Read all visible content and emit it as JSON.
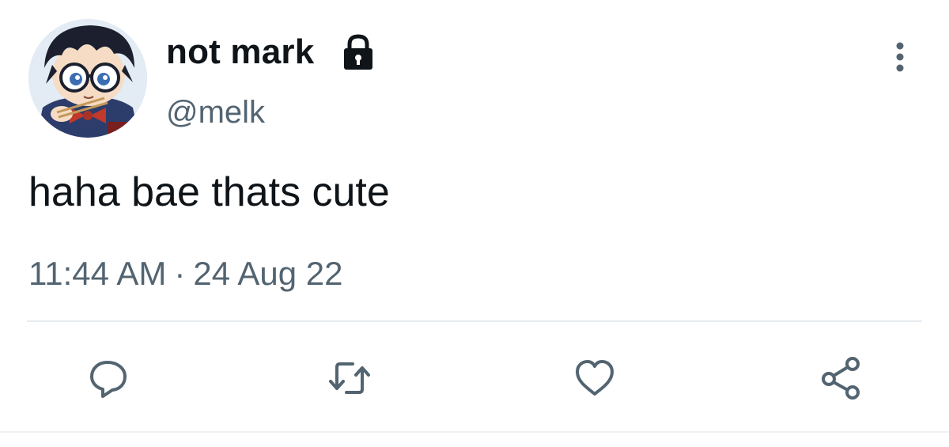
{
  "tweet": {
    "display_name": "not mark",
    "handle": "@melk",
    "text": "haha bae thats cute",
    "time": "11:44 AM",
    "separator": "·",
    "date": "24 Aug 22",
    "protected_icon": "lock-icon",
    "more_icon": "more-vertical-icon"
  },
  "actions": [
    {
      "name": "reply",
      "icon": "comment-icon"
    },
    {
      "name": "retweet",
      "icon": "retweet-icon"
    },
    {
      "name": "like",
      "icon": "heart-icon"
    },
    {
      "name": "share",
      "icon": "share-icon"
    }
  ],
  "colors": {
    "text_primary": "#0f1419",
    "text_secondary": "#536471",
    "icon": "#536471",
    "divider": "#e6ecf0",
    "background": "#ffffff"
  }
}
